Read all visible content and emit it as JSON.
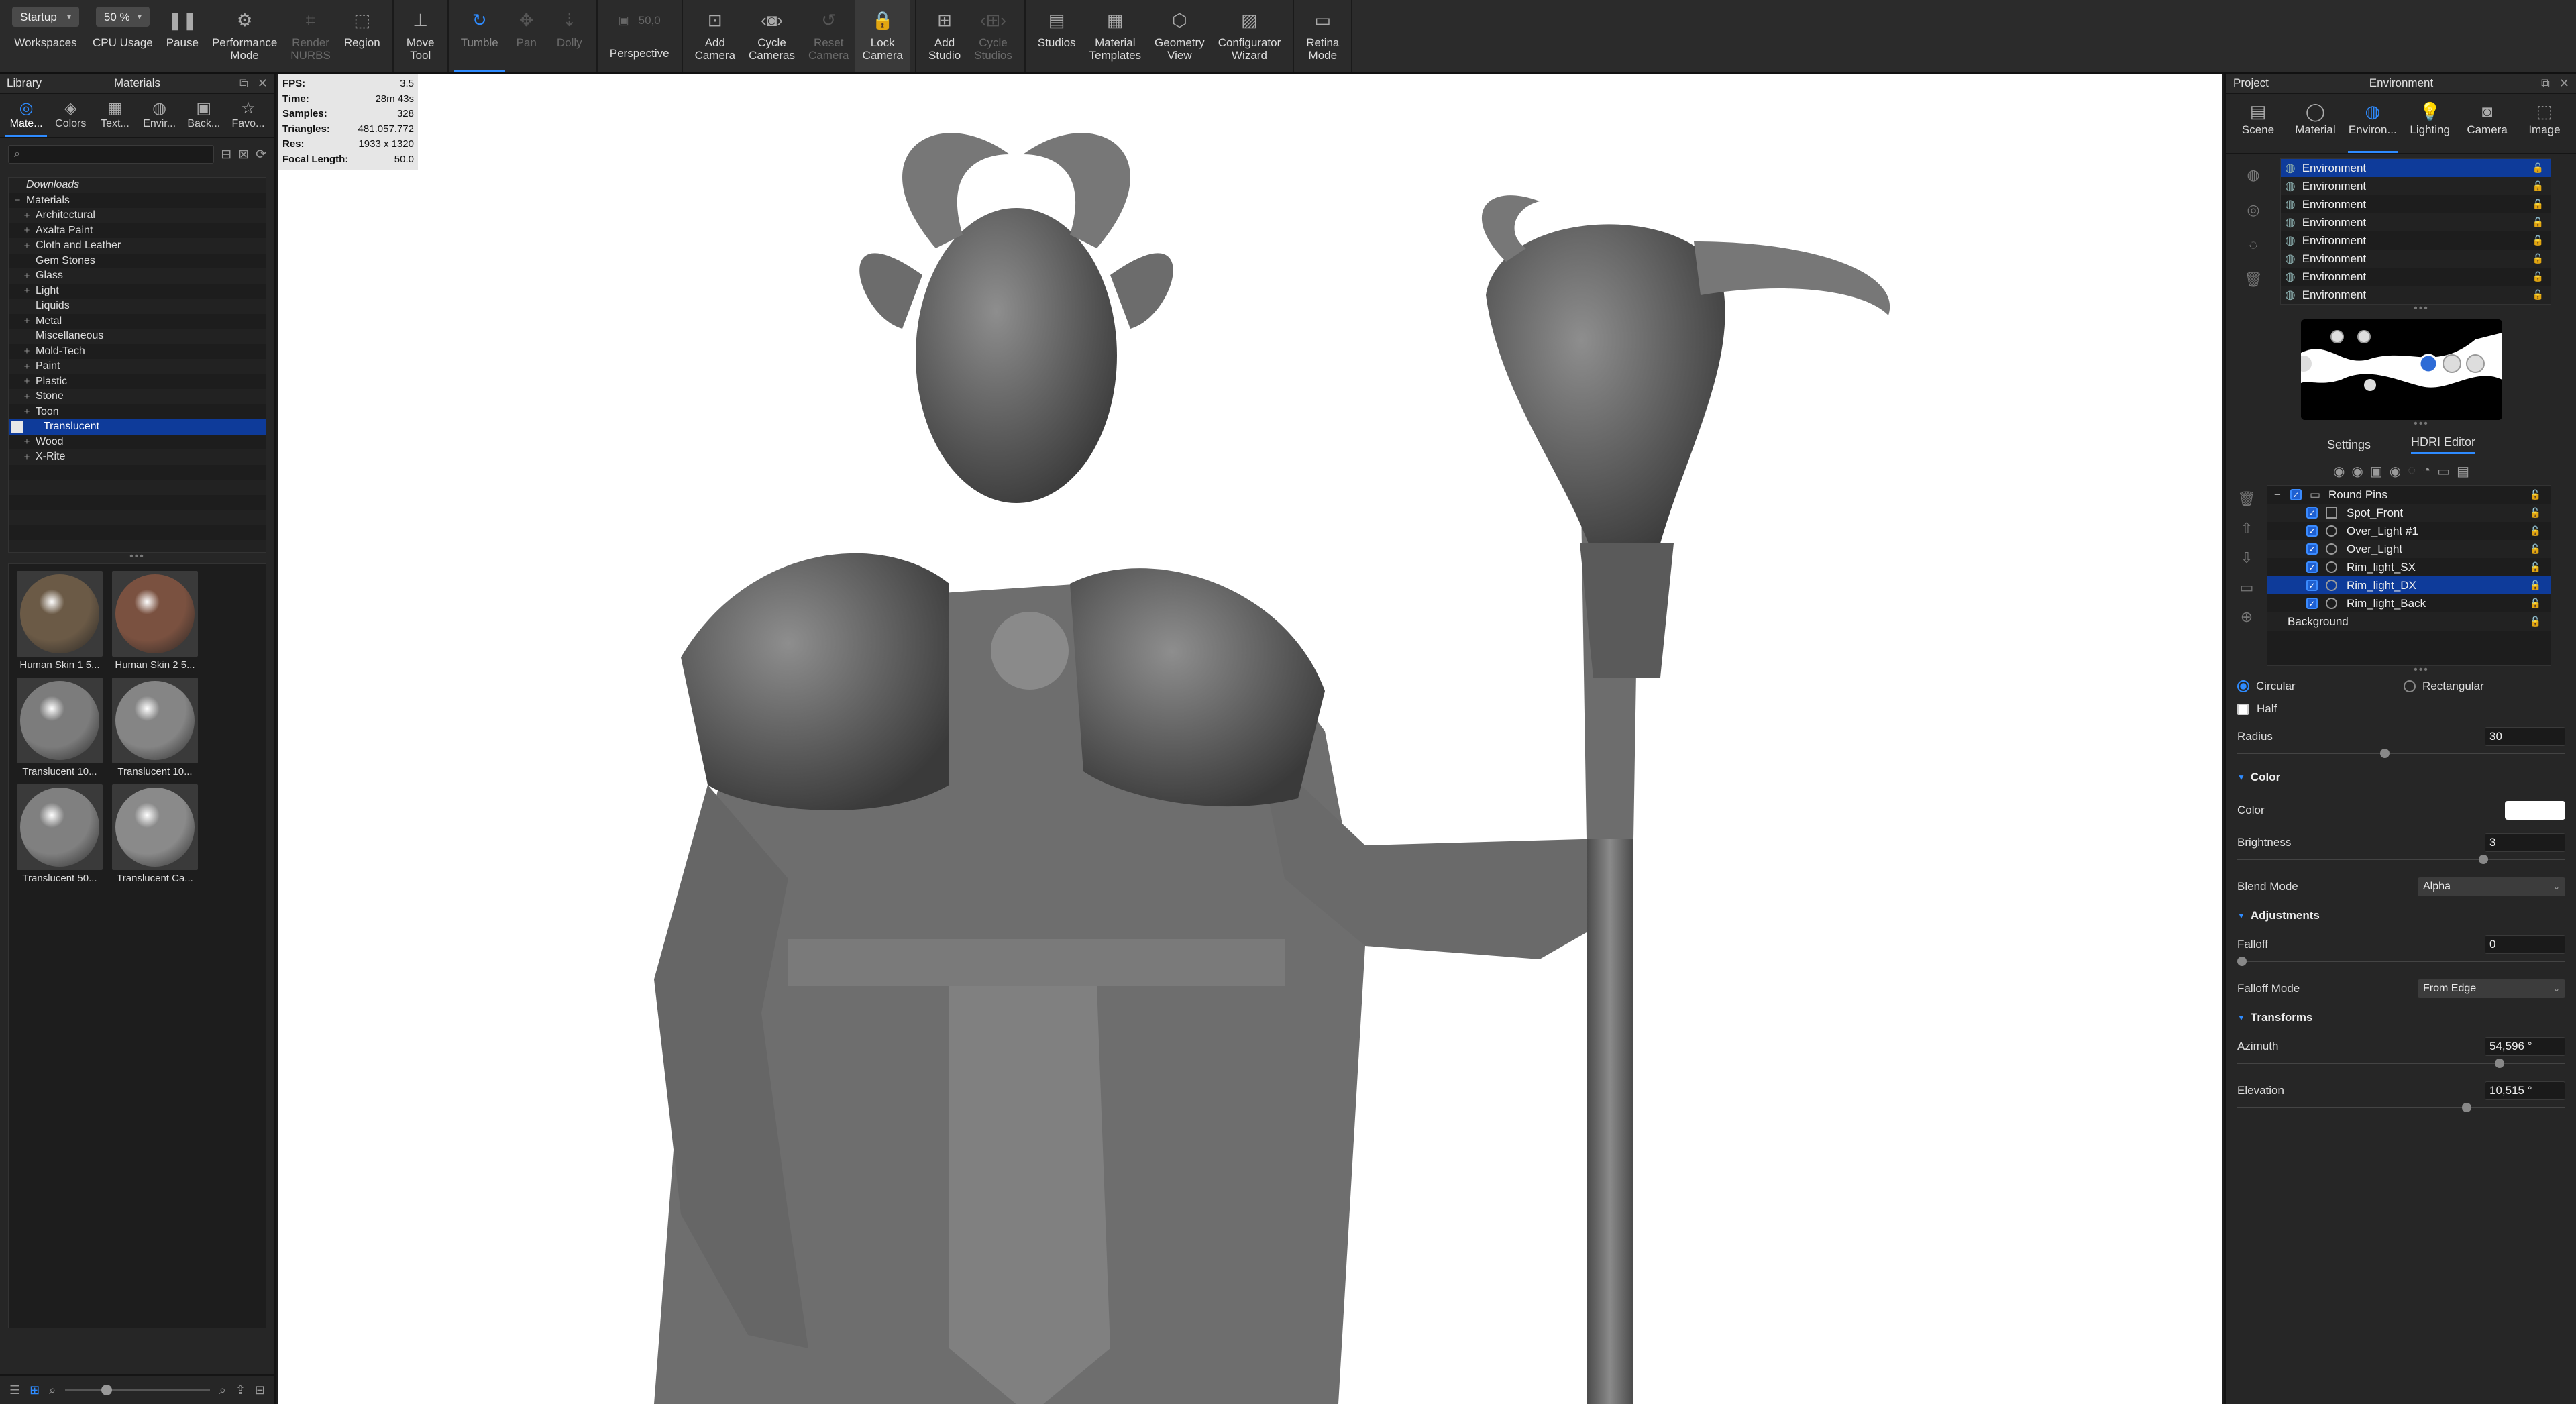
{
  "toolbar": {
    "workspaces_value": "Startup",
    "workspaces_label": "Workspaces",
    "cpu_value": "50 %",
    "cpu_label": "CPU Usage",
    "pause_label": "Pause",
    "performance_label": "Performance\nMode",
    "render_nurbs_label": "Render\nNURBS",
    "region_label": "Region",
    "move_tool_label": "Move\nTool",
    "tumble_label": "Tumble",
    "pan_label": "Pan",
    "dolly_label": "Dolly",
    "fov_value": "50,0",
    "perspective_label": "Perspective",
    "add_camera_label": "Add\nCamera",
    "cycle_cameras_label": "Cycle\nCameras",
    "reset_camera_label": "Reset\nCamera",
    "lock_camera_label": "Lock\nCamera",
    "add_studio_label": "Add\nStudio",
    "cycle_studios_label": "Cycle\nStudios",
    "studios_label": "Studios",
    "material_templates_label": "Material\nTemplates",
    "geometry_view_label": "Geometry\nView",
    "configurator_label": "Configurator\nWizard",
    "retina_label": "Retina\nMode"
  },
  "library": {
    "title": "Library",
    "subtitle": "Materials",
    "categories": [
      "Mate...",
      "Colors",
      "Text...",
      "Envir...",
      "Back...",
      "Favo..."
    ],
    "tree": [
      {
        "label": "Downloads",
        "exp": "",
        "italic": true
      },
      {
        "label": "Materials",
        "exp": "−"
      },
      {
        "label": "Architectural",
        "exp": "+"
      },
      {
        "label": "Axalta Paint",
        "exp": "+"
      },
      {
        "label": "Cloth and Leather",
        "exp": "+"
      },
      {
        "label": "Gem Stones",
        "exp": ""
      },
      {
        "label": "Glass",
        "exp": "+"
      },
      {
        "label": "Light",
        "exp": "+"
      },
      {
        "label": "Liquids",
        "exp": ""
      },
      {
        "label": "Metal",
        "exp": "+"
      },
      {
        "label": "Miscellaneous",
        "exp": ""
      },
      {
        "label": "Mold-Tech",
        "exp": "+"
      },
      {
        "label": "Paint",
        "exp": "+"
      },
      {
        "label": "Plastic",
        "exp": "+"
      },
      {
        "label": "Stone",
        "exp": "+"
      },
      {
        "label": "Toon",
        "exp": "+"
      },
      {
        "label": "Translucent",
        "exp": "",
        "selected": true
      },
      {
        "label": "Wood",
        "exp": "+"
      },
      {
        "label": "X-Rite",
        "exp": "+"
      }
    ],
    "thumbnails": [
      {
        "label": "Human Skin 1 5...",
        "color": "#6b5a46"
      },
      {
        "label": "Human Skin 2 5...",
        "color": "#7a5140"
      },
      {
        "label": "Translucent 10...",
        "color": "#7c7c7c"
      },
      {
        "label": "Translucent 10...",
        "color": "#858585"
      },
      {
        "label": "Translucent 50...",
        "color": "#808080"
      },
      {
        "label": "Translucent Ca...",
        "color": "#8a8a8a"
      }
    ]
  },
  "stats": [
    {
      "k": "FPS:",
      "v": "3.5"
    },
    {
      "k": "Time:",
      "v": "28m 43s"
    },
    {
      "k": "Samples:",
      "v": "328"
    },
    {
      "k": "Triangles:",
      "v": "481.057.772"
    },
    {
      "k": "Res:",
      "v": "1933 x 1320"
    },
    {
      "k": "Focal Length:",
      "v": "50.0"
    }
  ],
  "right": {
    "title": "Project",
    "subtitle": "Environment",
    "tabs": [
      "Scene",
      "Material",
      "Environ...",
      "Lighting",
      "Camera",
      "Image"
    ],
    "environments": [
      "Environment",
      "Environment",
      "Environment",
      "Environment",
      "Environment",
      "Environment",
      "Environment",
      "Environment"
    ],
    "sub_tabs": [
      "Settings",
      "HDRI Editor"
    ],
    "lights": [
      {
        "name": "Round Pins",
        "level": 0,
        "type": "folder",
        "checked": true
      },
      {
        "name": "Spot_Front",
        "level": 1,
        "type": "square",
        "checked": true
      },
      {
        "name": "Over_Light #1",
        "level": 1,
        "type": "circle",
        "checked": true
      },
      {
        "name": "Over_Light",
        "level": 1,
        "type": "circle",
        "checked": true
      },
      {
        "name": "Rim_light_SX",
        "level": 1,
        "type": "circle",
        "checked": true
      },
      {
        "name": "Rim_light_DX",
        "level": 1,
        "type": "circle",
        "checked": true,
        "selected": true
      },
      {
        "name": "Rim_light_Back",
        "level": 1,
        "type": "circle",
        "checked": true
      },
      {
        "name": "Background",
        "level": -1,
        "type": "none",
        "checked": false
      }
    ],
    "shape_circular": "Circular",
    "shape_rectangular": "Rectangular",
    "half_label": "Half",
    "radius_label": "Radius",
    "radius_value": "30",
    "radius_level": 0.45,
    "color_section": "Color",
    "color_label": "Color",
    "brightness_label": "Brightness",
    "brightness_value": "3",
    "brightness_level": 0.75,
    "blend_label": "Blend Mode",
    "blend_value": "Alpha",
    "adjustments_section": "Adjustments",
    "falloff_label": "Falloff",
    "falloff_value": "0",
    "falloff_level": 0.0,
    "falloff_mode_label": "Falloff Mode",
    "falloff_mode_value": "From Edge",
    "transforms_section": "Transforms",
    "azimuth_label": "Azimuth",
    "azimuth_value": "54,596 °",
    "azimuth_level": 0.8,
    "elevation_label": "Elevation",
    "elevation_value": "10,515 °",
    "elevation_level": 0.7
  }
}
